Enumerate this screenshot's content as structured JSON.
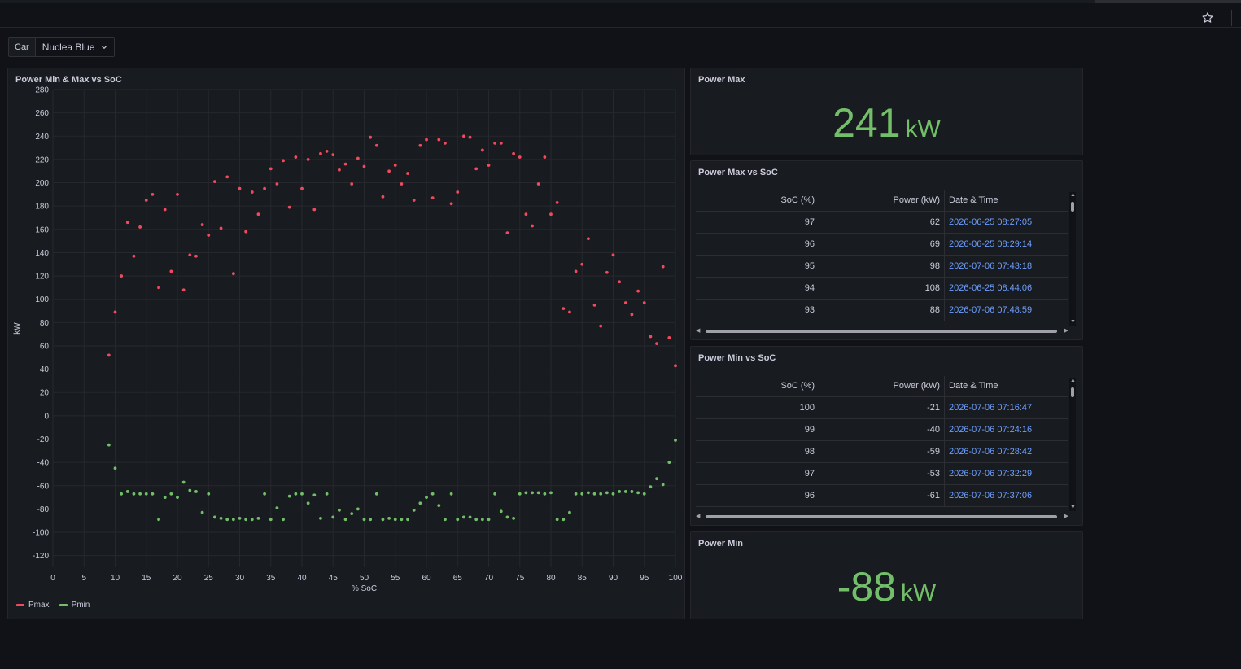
{
  "variables": {
    "label": "Car",
    "value": "Nuclea Blue"
  },
  "power_max_stat": {
    "title": "Power Max",
    "value": "241",
    "unit": "kW"
  },
  "power_min_stat": {
    "title": "Power Min",
    "value": "-88",
    "unit": "kW"
  },
  "max_table": {
    "title": "Power Max vs SoC",
    "columns": [
      "SoC (%)",
      "Power (kW)",
      "Date & Time"
    ],
    "rows": [
      [
        "97",
        "62",
        "2026-06-25 08:27:05"
      ],
      [
        "96",
        "69",
        "2026-06-25 08:29:14"
      ],
      [
        "95",
        "98",
        "2026-07-06 07:43:18"
      ],
      [
        "94",
        "108",
        "2026-06-25 08:44:06"
      ],
      [
        "93",
        "88",
        "2026-07-06 07:48:59"
      ]
    ]
  },
  "min_table": {
    "title": "Power Min vs SoC",
    "columns": [
      "SoC (%)",
      "Power (kW)",
      "Date & Time"
    ],
    "rows": [
      [
        "100",
        "-21",
        "2026-07-06 07:16:47"
      ],
      [
        "99",
        "-40",
        "2026-07-06 07:24:16"
      ],
      [
        "98",
        "-59",
        "2026-07-06 07:28:42"
      ],
      [
        "97",
        "-53",
        "2026-07-06 07:32:29"
      ],
      [
        "96",
        "-61",
        "2026-07-06 07:37:06"
      ]
    ]
  },
  "chart_data": {
    "type": "scatter",
    "title": "Power Min & Max vs SoC",
    "xlabel": "% SoC",
    "ylabel": "kW",
    "xlim": [
      0,
      100
    ],
    "ylim": [
      -130,
      280
    ],
    "xticks": [
      0,
      5,
      10,
      15,
      20,
      25,
      30,
      35,
      40,
      45,
      50,
      55,
      60,
      65,
      70,
      75,
      80,
      85,
      90,
      95,
      100
    ],
    "yticks": [
      -120,
      -100,
      -80,
      -60,
      -40,
      -20,
      0,
      20,
      40,
      60,
      80,
      100,
      120,
      140,
      160,
      180,
      200,
      220,
      240,
      260,
      280
    ],
    "grid": true,
    "legend": "bottom-left",
    "series": [
      {
        "name": "Pmax",
        "color": "#f2495c",
        "x": [
          9,
          10,
          11,
          12,
          13,
          14,
          15,
          16,
          17,
          18,
          19,
          20,
          21,
          22,
          23,
          24,
          25,
          26,
          27,
          28,
          29,
          30,
          31,
          32,
          33,
          34,
          35,
          36,
          37,
          38,
          39,
          40,
          41,
          42,
          43,
          44,
          45,
          46,
          47,
          48,
          49,
          50,
          51,
          52,
          53,
          54,
          55,
          56,
          57,
          58,
          59,
          60,
          61,
          62,
          63,
          64,
          65,
          66,
          67,
          68,
          69,
          70,
          71,
          72,
          73,
          74,
          75,
          76,
          77,
          78,
          79,
          80,
          81,
          82,
          83,
          84,
          85,
          86,
          87,
          88,
          89,
          90,
          91,
          92,
          93,
          94,
          95,
          96,
          97,
          98,
          99,
          100
        ],
        "y": [
          52,
          89,
          120,
          166,
          137,
          162,
          185,
          190,
          110,
          177,
          124,
          190,
          108,
          138,
          137,
          164,
          155,
          201,
          161,
          205,
          122,
          195,
          158,
          192,
          173,
          195,
          212,
          199,
          219,
          179,
          222,
          195,
          220,
          177,
          225,
          227,
          224,
          211,
          216,
          199,
          221,
          214,
          239,
          232,
          188,
          210,
          215,
          199,
          208,
          185,
          232,
          237,
          187,
          237,
          234,
          182,
          192,
          240,
          239,
          212,
          228,
          215,
          234,
          234,
          157,
          225,
          222,
          173,
          163,
          199,
          222,
          173,
          183,
          92,
          89,
          124,
          130,
          152,
          95,
          77,
          123,
          138,
          115,
          97,
          87,
          107,
          97,
          68,
          62,
          128,
          67,
          43
        ]
      },
      {
        "name": "Pmin",
        "color": "#73bf69",
        "x": [
          9,
          10,
          11,
          12,
          13,
          14,
          15,
          16,
          17,
          18,
          19,
          20,
          21,
          22,
          23,
          24,
          25,
          26,
          27,
          28,
          29,
          30,
          31,
          32,
          33,
          34,
          35,
          36,
          37,
          38,
          39,
          40,
          41,
          42,
          43,
          44,
          45,
          46,
          47,
          48,
          49,
          50,
          51,
          52,
          53,
          54,
          55,
          56,
          57,
          58,
          59,
          60,
          61,
          62,
          63,
          64,
          65,
          66,
          67,
          68,
          69,
          70,
          71,
          72,
          73,
          74,
          75,
          76,
          77,
          78,
          79,
          80,
          81,
          82,
          83,
          84,
          85,
          86,
          87,
          88,
          89,
          90,
          91,
          92,
          93,
          94,
          95,
          96,
          97,
          98,
          99,
          100
        ],
        "y": [
          -25,
          -45,
          -67,
          -65,
          -67,
          -67,
          -67,
          -67,
          -89,
          -70,
          -67,
          -70,
          -57,
          -64,
          -65,
          -83,
          -67,
          -87,
          -88,
          -89,
          -89,
          -88,
          -89,
          -89,
          -88,
          -67,
          -89,
          -79,
          -89,
          -69,
          -67,
          -67,
          -75,
          -68,
          -88,
          -67,
          -87,
          -81,
          -89,
          -84,
          -80,
          -89,
          -89,
          -67,
          -89,
          -88,
          -89,
          -89,
          -89,
          -81,
          -75,
          -70,
          -67,
          -77,
          -89,
          -67,
          -89,
          -87,
          -87,
          -89,
          -89,
          -89,
          -67,
          -82,
          -87,
          -88,
          -67,
          -66,
          -66,
          -66,
          -67,
          -66,
          -89,
          -89,
          -83,
          -67,
          -67,
          -66,
          -67,
          -67,
          -66,
          -67,
          -65,
          -65,
          -65,
          -66,
          -67,
          -61,
          -54,
          -59,
          -40,
          -21
        ]
      }
    ]
  }
}
